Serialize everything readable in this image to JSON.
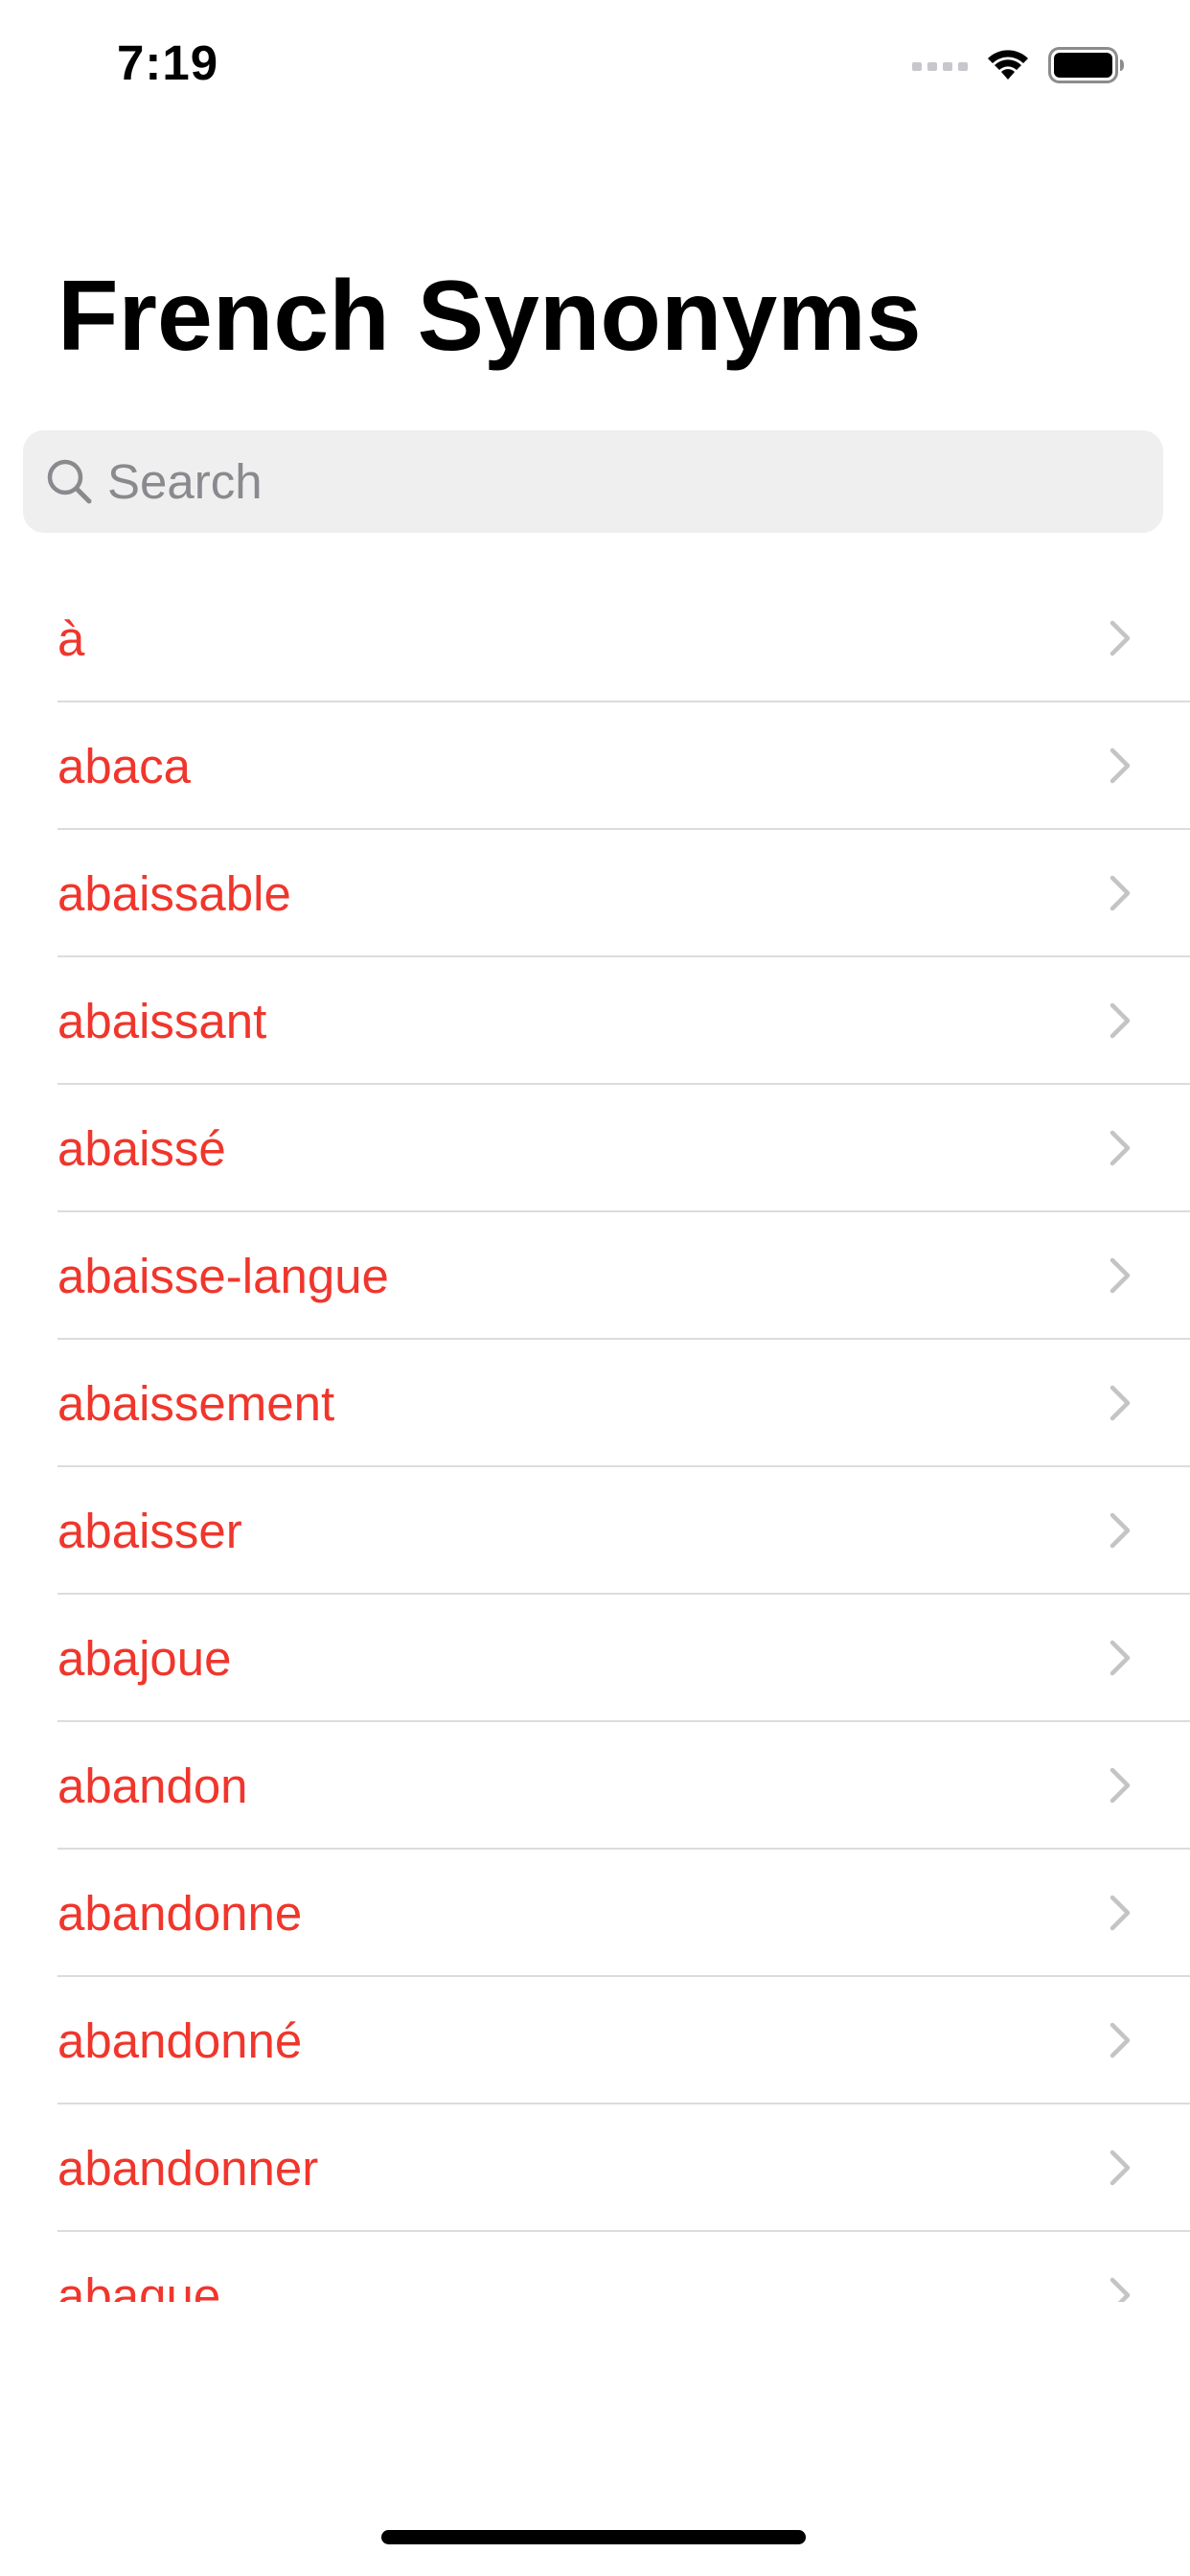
{
  "status_bar": {
    "time": "7:19",
    "icons": [
      "cellular-signal-icon",
      "wifi-icon",
      "battery-icon"
    ]
  },
  "header": {
    "title": "French Synonyms"
  },
  "search": {
    "placeholder": "Search",
    "value": "",
    "icon": "search-icon"
  },
  "list": {
    "items": [
      {
        "label": "à"
      },
      {
        "label": "abaca"
      },
      {
        "label": "abaissable"
      },
      {
        "label": "abaissant"
      },
      {
        "label": "abaissé"
      },
      {
        "label": "abaisse-langue"
      },
      {
        "label": "abaissement"
      },
      {
        "label": "abaisser"
      },
      {
        "label": "abajoue"
      },
      {
        "label": "abandon"
      },
      {
        "label": "abandonne"
      },
      {
        "label": "abandonné"
      },
      {
        "label": "abandonner"
      },
      {
        "label": "abaque"
      }
    ],
    "chevron_icon": "chevron-right-icon"
  },
  "colors": {
    "accent": "#f0362c",
    "search_bg": "#efeff0",
    "placeholder": "#8a8a8e",
    "chevron": "#c4c4c7",
    "separator": "#dcdcde"
  }
}
